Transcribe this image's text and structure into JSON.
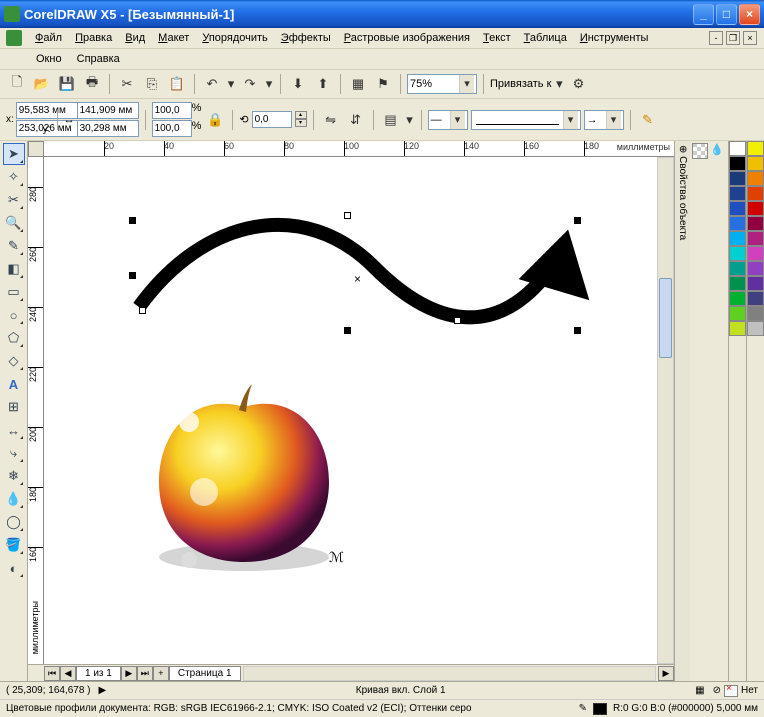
{
  "window": {
    "title": "CorelDRAW X5 - [Безымянный-1]"
  },
  "menu": {
    "items": [
      "Файл",
      "Правка",
      "Вид",
      "Макет",
      "Упорядочить",
      "Эффекты",
      "Растровые изображения",
      "Текст",
      "Таблица",
      "Инструменты"
    ],
    "items2": [
      "Окно",
      "Справка"
    ]
  },
  "toolbar1": {
    "zoom": "75%",
    "snap_label": "Привязать к"
  },
  "propbar": {
    "x": "95,583 мм",
    "y": "253,026 мм",
    "w": "141,909 мм",
    "h": "30,298 мм",
    "sx": "100,0",
    "sy": "100,0",
    "pct": "%",
    "rot": "0,0",
    "deg": "°",
    "line": "—",
    "ruler_unit": "миллиметры"
  },
  "pagebar": {
    "pageinfo": "1 из 1",
    "tab": "Страница 1"
  },
  "rightpanel": {
    "title": "⊕ Свойства объекта"
  },
  "status": {
    "coords": "( 25,309; 164,678 )",
    "objinfo": "Кривая вкл. Слой 1",
    "fill": "Нет",
    "colorinfo": "R:0 G:0 B:0 (#000000) 5,000 мм"
  },
  "status2": {
    "profiles": "Цветовые профили документа: RGB: sRGB IEC61966-2.1; CMYK: ISO Coated v2 (ECI); Оттенки серо"
  },
  "ruler_h": [
    20,
    40,
    60,
    80,
    100,
    120,
    140,
    160,
    180
  ],
  "ruler_v": [
    280,
    260,
    240,
    220,
    200,
    180,
    160
  ],
  "palette": [
    "#ffffff",
    "#000000",
    "#1a3a7a",
    "#204090",
    "#2050c0",
    "#2870e0",
    "#00b0f0",
    "#00d0d0",
    "#00a090",
    "#009050",
    "#00b030",
    "#60d020",
    "#c0e020",
    "#f0f000",
    "#f0c000",
    "#f08000",
    "#e04000",
    "#d00000",
    "#900040",
    "#b02080",
    "#d040c0",
    "#9040c0",
    "#6030a0",
    "#404080",
    "#808080",
    "#c0c0c0"
  ]
}
